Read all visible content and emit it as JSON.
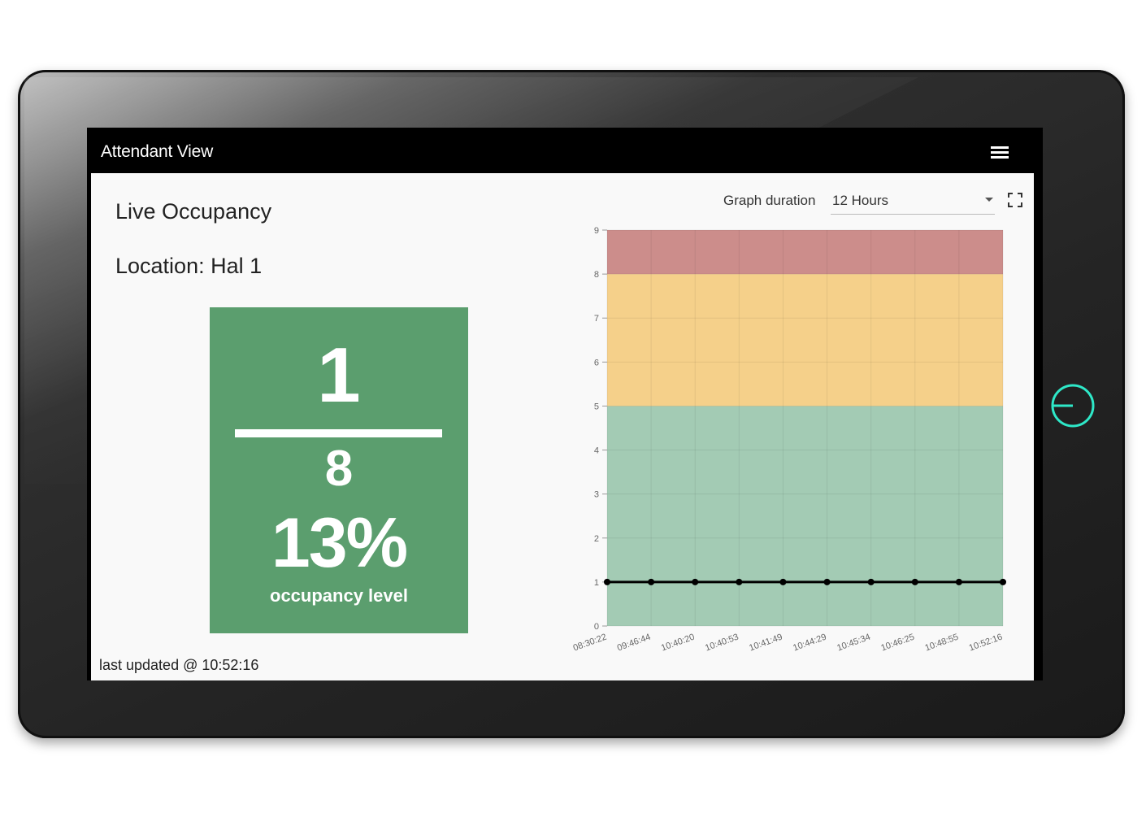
{
  "header": {
    "title": "Attendant View",
    "menu_icon": "hamburger-menu-icon"
  },
  "main": {
    "heading": "Live Occupancy",
    "location": "Location: Hal 1",
    "occupancy": {
      "current": "1",
      "capacity": "8",
      "percent": "13%",
      "label": "occupancy level",
      "card_color": "#5b9e6e"
    },
    "last_updated": "last updated @ 10:52:16"
  },
  "graph_controls": {
    "duration_label": "Graph duration",
    "duration_value": "12 Hours",
    "dropdown_icon": "chevron-down-icon",
    "fullscreen_icon": "fullscreen-icon"
  },
  "colors": {
    "green_zone": "#a3cbb4",
    "yellow_zone": "#f5d08a",
    "red_zone": "#cc8d8b",
    "line": "#000000",
    "power_ring": "#2ee8c8"
  },
  "chart_data": {
    "type": "line",
    "x": [
      "08:30:22",
      "09:46:44",
      "10:40:20",
      "10:40:53",
      "10:41:49",
      "10:44:29",
      "10:45:34",
      "10:46:25",
      "10:48:55",
      "10:52:16"
    ],
    "series": [
      {
        "values": [
          1,
          1,
          1,
          1,
          1,
          1,
          1,
          1,
          1,
          1
        ]
      }
    ],
    "ylim": [
      0,
      9
    ],
    "yticks": [
      0,
      1,
      2,
      3,
      4,
      5,
      6,
      7,
      8,
      9
    ],
    "bands": [
      {
        "from": 0,
        "to": 5,
        "color": "#a3cbb4"
      },
      {
        "from": 5,
        "to": 8,
        "color": "#f5d08a"
      },
      {
        "from": 8,
        "to": 9,
        "color": "#cc8d8b"
      }
    ],
    "grid": true
  }
}
